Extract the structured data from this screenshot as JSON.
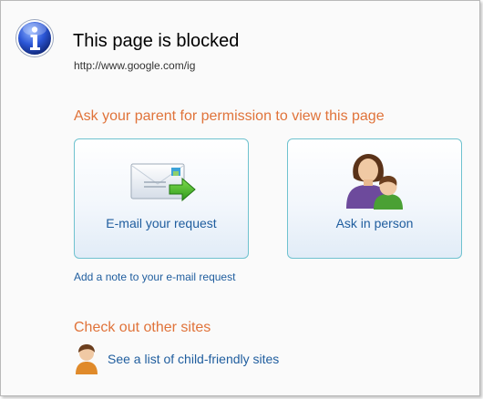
{
  "page": {
    "title": "This page is blocked",
    "url": "http://www.google.com/ig"
  },
  "permission": {
    "heading": "Ask your parent for permission to view this page",
    "email_label": "E-mail your request",
    "person_label": "Ask in person",
    "add_note_link": "Add a note to your e-mail request"
  },
  "other_sites": {
    "heading": "Check out other sites",
    "link": "See a list of child-friendly sites"
  },
  "colors": {
    "heading": "#e0733a",
    "link": "#1f5d9e",
    "card_border": "#6fc2cf"
  },
  "icons": [
    "info-icon",
    "email-arrow-icon",
    "parent-child-icon",
    "child-icon"
  ]
}
